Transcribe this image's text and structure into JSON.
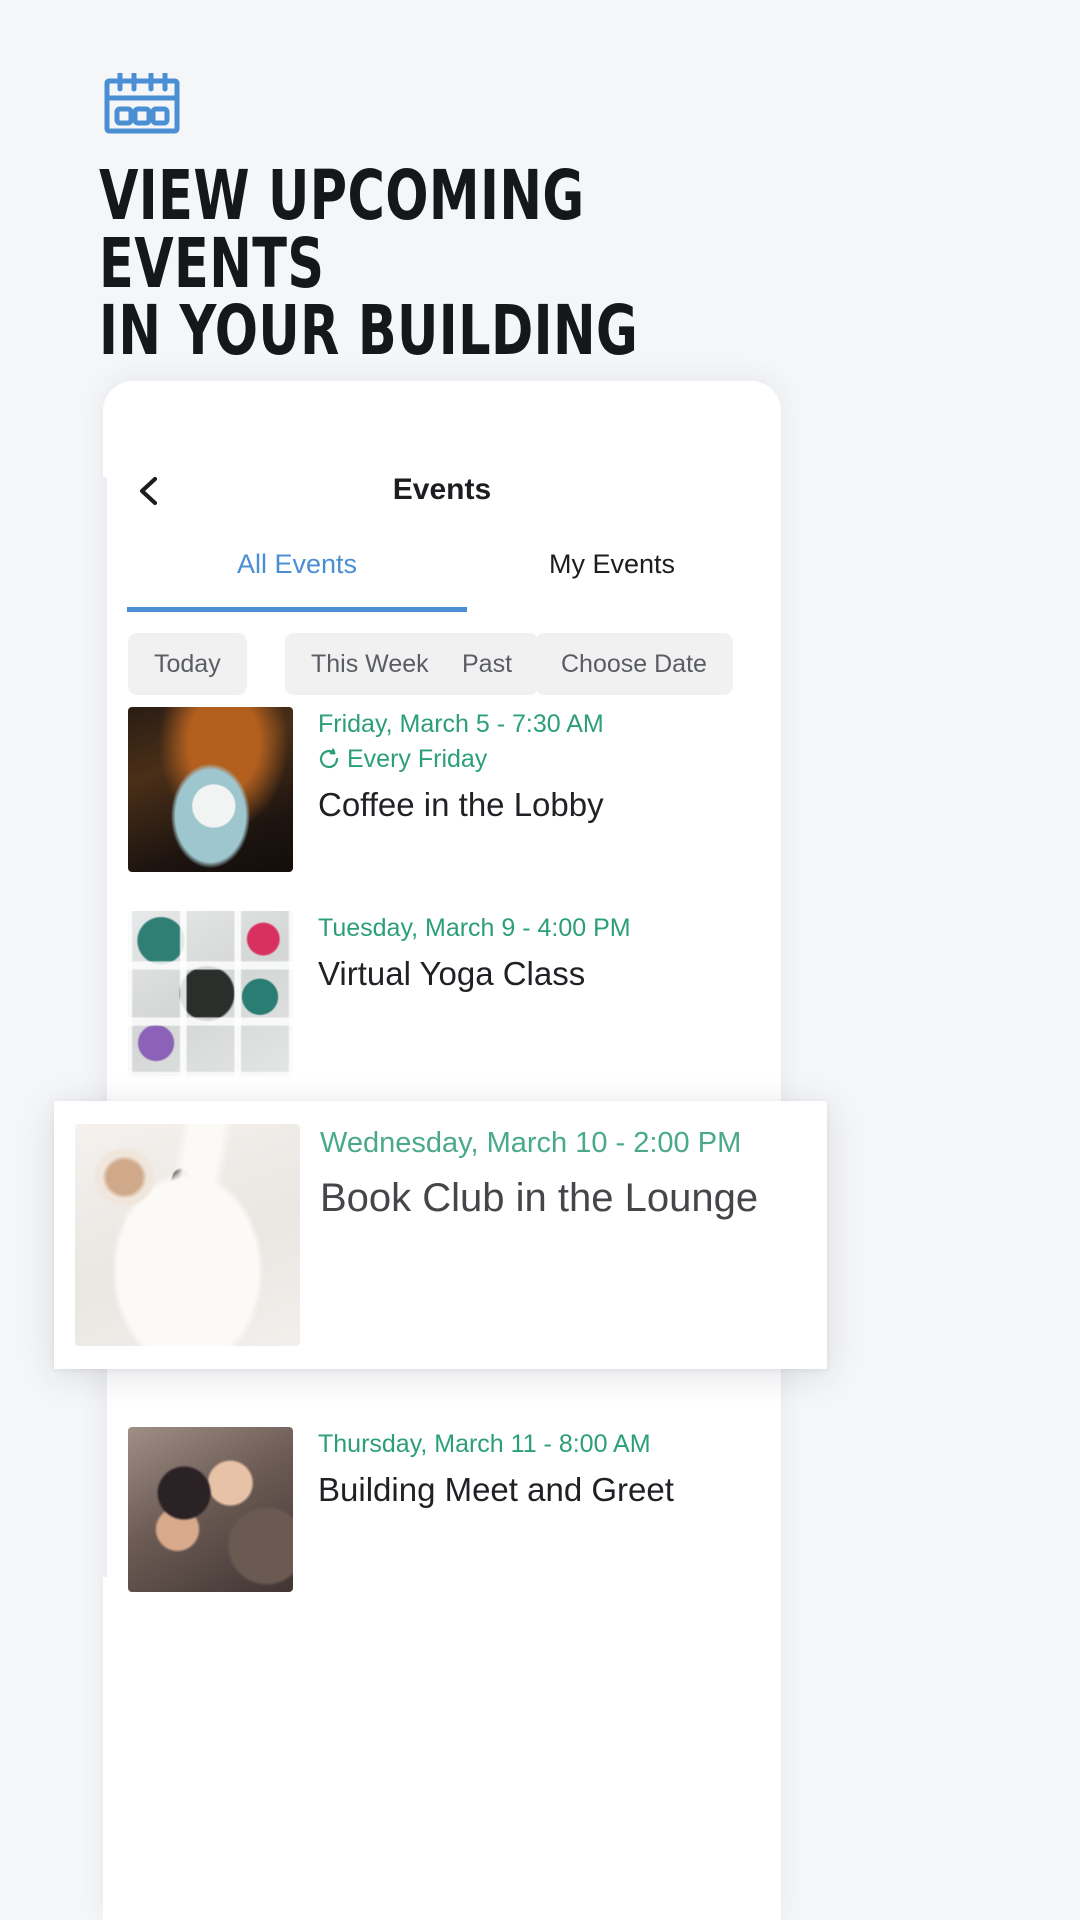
{
  "promo": {
    "icon": "calendar-icon",
    "icon_color": "#4a8fd4",
    "title": "VIEW UPCOMING EVENTS\nIN YOUR BUILDING"
  },
  "app": {
    "header": {
      "back_icon": "chevron-left-icon",
      "title": "Events"
    },
    "tabs": [
      {
        "label": "All Events",
        "active": true
      },
      {
        "label": "My Events",
        "active": false
      }
    ],
    "filters": [
      {
        "label": "Today"
      },
      {
        "label": "This Week"
      },
      {
        "label": "Past"
      },
      {
        "label": "Choose Date"
      }
    ],
    "events": [
      {
        "date": "Friday, March 5 - 7:30 AM",
        "repeat_icon": "repeat-icon",
        "repeat": "Every Friday",
        "title": "Coffee in the Lobby",
        "thumbnail": "coffee-cup-photo"
      },
      {
        "date": "Tuesday, March 9 - 4:00 PM",
        "repeat": "",
        "title": "Virtual Yoga Class",
        "thumbnail": "yoga-mats-photo"
      },
      {
        "date": "Thursday, March 11 - 8:00 AM",
        "repeat": "",
        "title": "Building Meet and Greet",
        "thumbnail": "people-smiling-photo"
      }
    ],
    "highlighted_event": {
      "date": "Wednesday, March 10 - 2:00 PM",
      "title": "Book Club in the Lounge",
      "thumbnail": "book-and-coffee-photo"
    }
  },
  "colors": {
    "page_bg": "#f5f6f8",
    "accent_blue": "#4a8fd4",
    "date_green": "#2b9e7a",
    "chip_bg": "#f1f1f2",
    "text_dark": "#1b1d20"
  }
}
